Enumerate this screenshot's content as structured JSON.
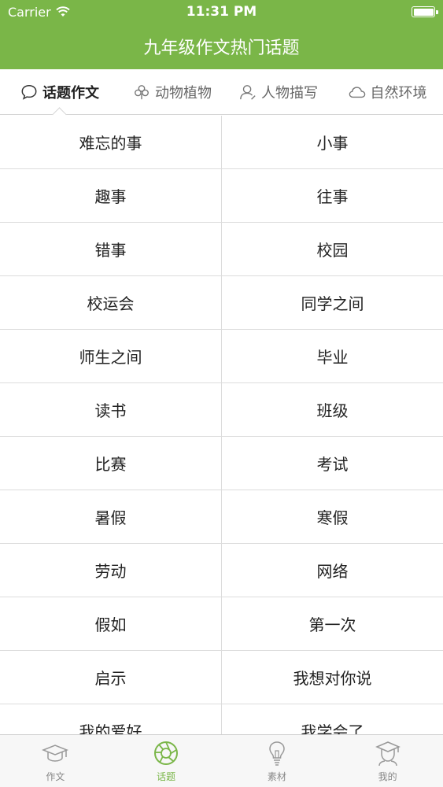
{
  "status_bar": {
    "carrier": "Carrier",
    "time": "11:31 PM",
    "battery_level": 1.0
  },
  "nav": {
    "title": "九年级作文热门话题"
  },
  "tabs": [
    {
      "label": "话题作文",
      "icon": "speech-bubble-icon",
      "active": true
    },
    {
      "label": "动物植物",
      "icon": "clover-icon",
      "active": false
    },
    {
      "label": "人物描写",
      "icon": "person-icon",
      "active": false
    },
    {
      "label": "自然环境",
      "icon": "cloud-icon",
      "active": false
    }
  ],
  "topics": [
    [
      "难忘的事",
      "小事"
    ],
    [
      "趣事",
      "往事"
    ],
    [
      "错事",
      "校园"
    ],
    [
      "校运会",
      "同学之间"
    ],
    [
      "师生之间",
      "毕业"
    ],
    [
      "读书",
      "班级"
    ],
    [
      "比赛",
      "考试"
    ],
    [
      "暑假",
      "寒假"
    ],
    [
      "劳动",
      "网络"
    ],
    [
      "假如",
      "第一次"
    ],
    [
      "启示",
      "我想对你说"
    ],
    [
      "我的爱好",
      "我学会了"
    ]
  ],
  "bottom_tabs": [
    {
      "label": "作文",
      "icon": "graduation-cap-icon",
      "active": false
    },
    {
      "label": "话题",
      "icon": "aperture-icon",
      "active": true
    },
    {
      "label": "素材",
      "icon": "lightbulb-icon",
      "active": false
    },
    {
      "label": "我的",
      "icon": "student-avatar-icon",
      "active": false
    }
  ],
  "colors": {
    "accent": "#7ab648",
    "inactive": "#888888"
  }
}
